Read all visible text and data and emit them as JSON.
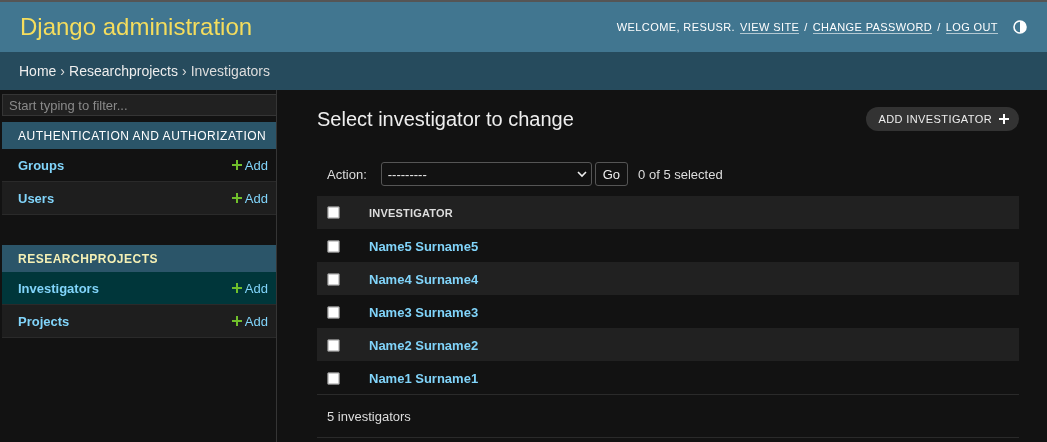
{
  "header": {
    "title": "Django administration",
    "welcome": "WELCOME, RESUSR.",
    "links": [
      "VIEW SITE",
      "CHANGE PASSWORD",
      "LOG OUT"
    ],
    "separator": "/"
  },
  "breadcrumbs": {
    "items": [
      "Home",
      "Researchprojects",
      "Investigators"
    ],
    "separator": "›"
  },
  "sidebar": {
    "filter_placeholder": "Start typing to filter...",
    "apps": [
      {
        "name": "AUTHENTICATION AND AUTHORIZATION",
        "selected": false,
        "models": [
          {
            "name": "Groups",
            "add": "Add",
            "selected": false
          },
          {
            "name": "Users",
            "add": "Add",
            "selected": false
          }
        ]
      },
      {
        "name": "RESEARCHPROJECTS",
        "selected": true,
        "models": [
          {
            "name": "Investigators",
            "add": "Add",
            "selected": true
          },
          {
            "name": "Projects",
            "add": "Add",
            "selected": false
          }
        ]
      }
    ]
  },
  "content": {
    "title": "Select investigator to change",
    "add_button": "ADD INVESTIGATOR",
    "action_label": "Action:",
    "action_value": "---------",
    "go": "Go",
    "selection_count": "0 of 5 selected",
    "select_all_checked": false,
    "column": "INVESTIGATOR",
    "rows": [
      {
        "name": "Name5 Surname5",
        "checked": false
      },
      {
        "name": "Name4 Surname4",
        "checked": false
      },
      {
        "name": "Name3 Surname3",
        "checked": false
      },
      {
        "name": "Name2 Surname2",
        "checked": false
      },
      {
        "name": "Name1 Surname1",
        "checked": false
      }
    ],
    "footer": "5 investigators"
  }
}
